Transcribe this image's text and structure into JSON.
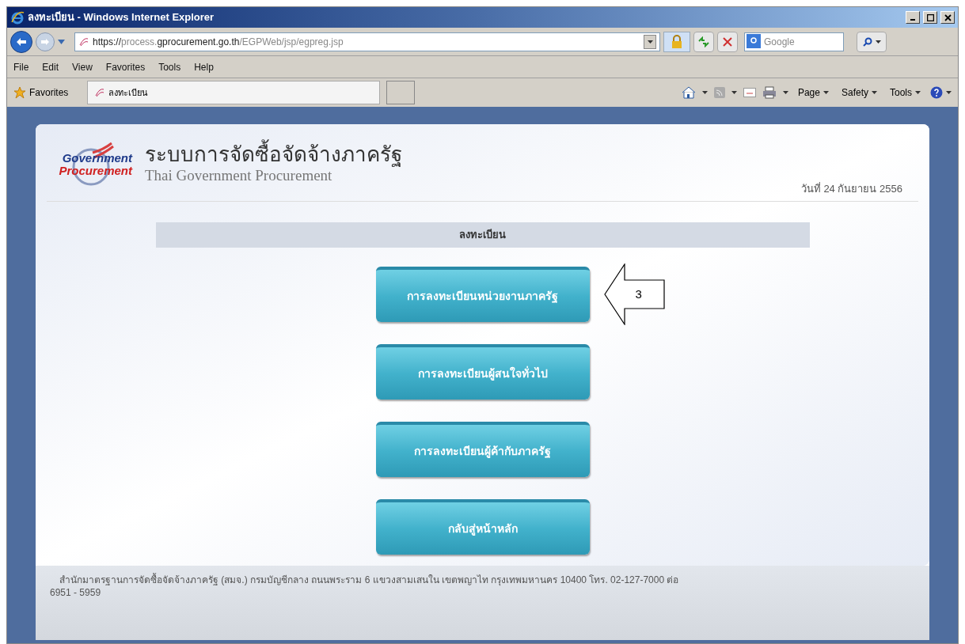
{
  "window": {
    "title": "ลงทะเบียน - Windows Internet Explorer"
  },
  "address_bar": {
    "scheme": "https://",
    "host_prefix": "process.",
    "domain": "gprocurement.go.th",
    "path": "/EGPWeb/jsp/egpreg.jsp"
  },
  "search": {
    "placeholder": "Google"
  },
  "menu": [
    "File",
    "Edit",
    "View",
    "Favorites",
    "Tools",
    "Help"
  ],
  "favorites_bar": {
    "label": "Favorites",
    "tab": "ลงทะเบียน"
  },
  "command_bar": [
    "Page",
    "Safety",
    "Tools"
  ],
  "page": {
    "logo": {
      "line_1": "Government",
      "line_2": "Procurement"
    },
    "title": "ระบบการจัดซื้อจัดจ้างภาครัฐ",
    "subtitle": "Thai Government Procurement",
    "date": "วันที่ 24 กันยายน 2556",
    "section_heading": "ลงทะเบียน",
    "buttons": [
      {
        "label": "การลงทะเบียนหน่วยงานภาครัฐ",
        "callout": "3"
      },
      {
        "label": "การลงทะเบียนผู้สนใจทั่วไป"
      },
      {
        "label": "การลงทะเบียนผู้ค้ากับภาครัฐ"
      },
      {
        "label": "กลับสู่หน้าหลัก"
      }
    ],
    "footer": [
      "สำนักมาตรฐานการจัดซื้อจัดจ้างภาครัฐ (สมจ.) กรมบัญชีกลาง ถนนพระราม 6 แขวงสามเสนใน เขตพญาไท กรุงเทพมหานคร 10400 โทร. 02-127-7000 ต่อ",
      "6951 - 5959"
    ]
  }
}
